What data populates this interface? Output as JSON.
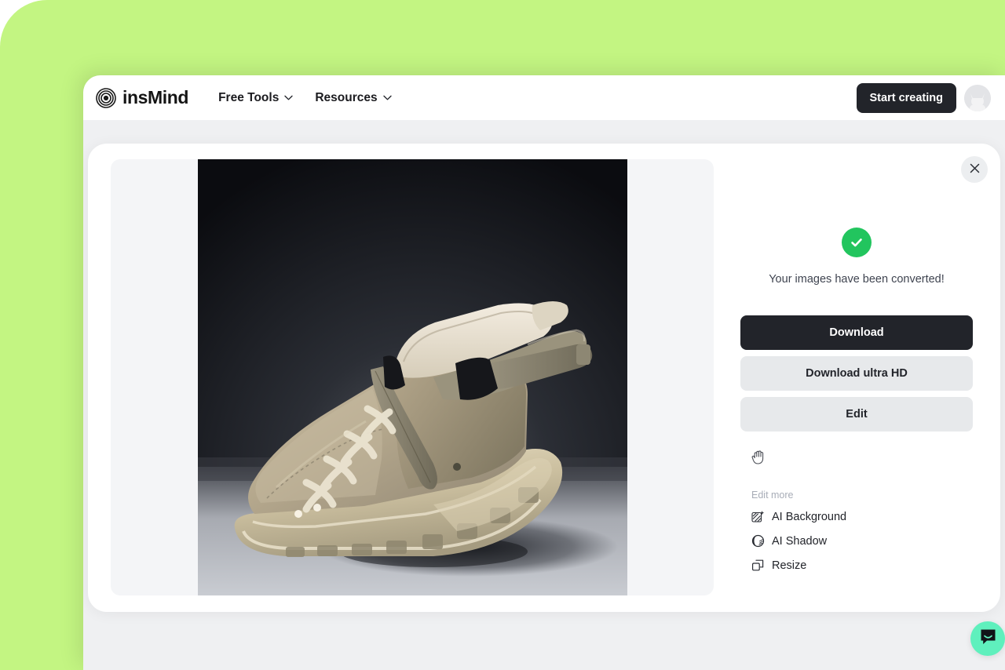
{
  "theme": {
    "backdrop_green": "#c3f582",
    "page_bg": "#eff0f2",
    "dark_button": "#22242a",
    "light_button": "#e7e9eb",
    "success_green": "#22c55e",
    "chat_green": "#5ff0bd",
    "canvas_bg": "#f4f5f7"
  },
  "header": {
    "logo_text": "insMind",
    "logo_icon": "concentric-circles-logo",
    "nav": [
      {
        "label": "Free Tools",
        "icon": "chevron-down-icon"
      },
      {
        "label": "Resources",
        "icon": "chevron-down-icon"
      }
    ],
    "cta_label": "Start creating",
    "avatar_icon": "user-avatar"
  },
  "modal": {
    "close_icon": "close-icon",
    "preview": {
      "image_alt": "beige high-top sneaker boot on dark background",
      "background": "#0e0f13"
    },
    "panel": {
      "status_icon": "check-circle-icon",
      "status_message": "Your images have been converted!",
      "buttons": [
        {
          "label": "Download",
          "style": "primary"
        },
        {
          "label": "Download ultra HD",
          "style": "secondary"
        },
        {
          "label": "Edit",
          "style": "secondary"
        }
      ],
      "cursor_icon": "grab-hand-cursor",
      "edit_more_label": "Edit more",
      "edit_more_items": [
        {
          "label": "AI Background",
          "icon": "ai-background-icon"
        },
        {
          "label": "AI Shadow",
          "icon": "ai-shadow-icon"
        },
        {
          "label": "Resize",
          "icon": "resize-icon"
        }
      ]
    }
  },
  "chat": {
    "icon": "chat-bubble-icon",
    "color": "#5ff0bd"
  }
}
